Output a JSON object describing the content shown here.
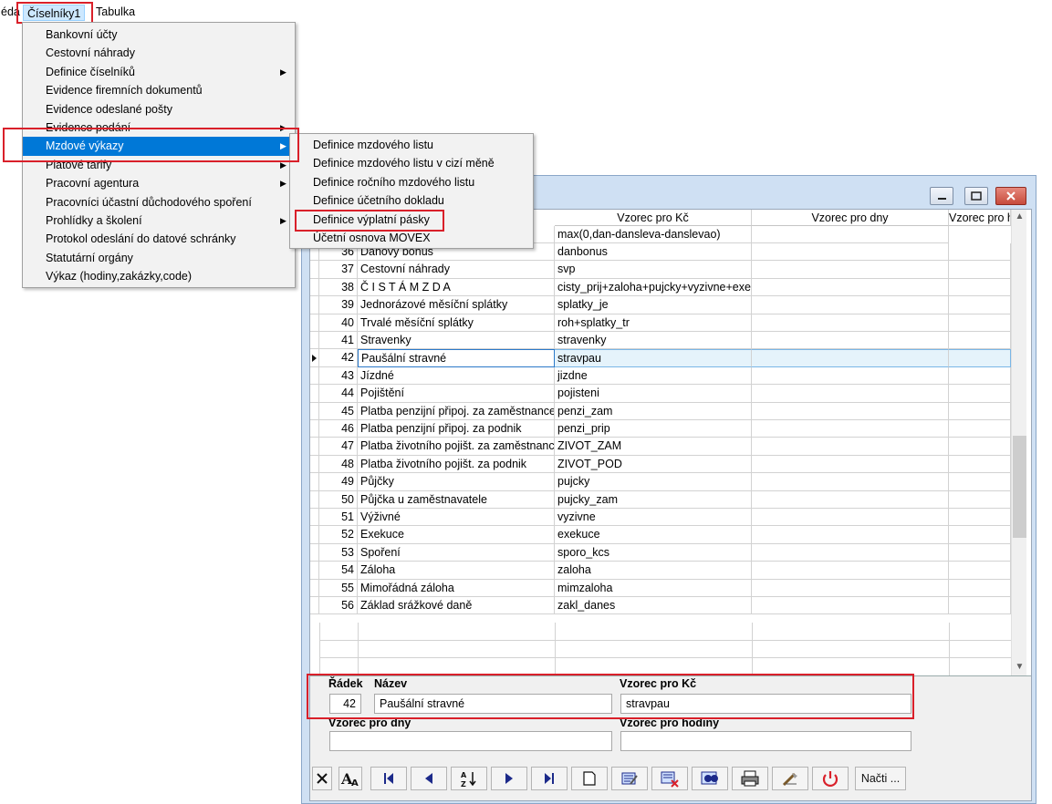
{
  "menubar": {
    "partial_left": "éda",
    "ciselniky": "Číselníky1",
    "tabulka": "Tabulka"
  },
  "menu1": [
    {
      "label": "Bankovní účty",
      "sub": false
    },
    {
      "label": "Cestovní náhrady",
      "sub": false
    },
    {
      "label": "Definice číselníků",
      "sub": true
    },
    {
      "label": "Evidence firemních dokumentů",
      "sub": false
    },
    {
      "label": "Evidence odeslané pošty",
      "sub": false
    },
    {
      "label": "Evidence podání",
      "sub": true
    },
    {
      "label": "Mzdové výkazy",
      "sub": true,
      "selected": true
    },
    {
      "label": "Platové tarify",
      "sub": true
    },
    {
      "label": "Pracovní agentura",
      "sub": true
    },
    {
      "label": "Pracovníci  účastní důchodového spoření",
      "sub": false
    },
    {
      "label": "Prohlídky a školení",
      "sub": true
    },
    {
      "label": "Protokol odeslání do datové schránky",
      "sub": false
    },
    {
      "label": "Statutární orgány",
      "sub": false
    },
    {
      "label": "Výkaz (hodiny,zakázky,code)",
      "sub": false
    }
  ],
  "menu2": [
    {
      "label": "Definice mzdového listu"
    },
    {
      "label": "Definice mzdového listu v cizí měně"
    },
    {
      "label": "Definice ročního mzdového listu"
    },
    {
      "label": "Definice účetního dokladu"
    },
    {
      "label": "Definice výplatní pásky"
    },
    {
      "label": "Účetní osnova MOVEX"
    }
  ],
  "grid": {
    "headers": [
      "Vzorec pro Kč",
      "Vzorec pro dny",
      "Vzorec pro h"
    ],
    "top_partial": {
      "formula": "max(0,dan-dansleva-danslevao)"
    },
    "rows": [
      {
        "num": "36",
        "name": "Daňový bonus",
        "formula": "danbonus"
      },
      {
        "num": "37",
        "name": "Cestovní náhrady",
        "formula": "svp"
      },
      {
        "num": "38",
        "name": "Č I S T Á  M Z D A",
        "formula": "cisty_prij+zaloha+pujcky+vyzivne+exe"
      },
      {
        "num": "39",
        "name": "Jednorázové měsíční splátky",
        "formula": "splatky_je"
      },
      {
        "num": "40",
        "name": "Trvalé měsíční splátky",
        "formula": "roh+splatky_tr"
      },
      {
        "num": "41",
        "name": "Stravenky",
        "formula": "stravenky"
      },
      {
        "num": "42",
        "name": "Paušální stravné",
        "formula": "stravpau",
        "current": true
      },
      {
        "num": "43",
        "name": "Jízdné",
        "formula": "jizdne"
      },
      {
        "num": "44",
        "name": "Pojištění",
        "formula": "pojisteni"
      },
      {
        "num": "45",
        "name": "Platba penzijní připoj. za zaměstnance",
        "formula": "penzi_zam"
      },
      {
        "num": "46",
        "name": "Platba penzijní připoj. za podnik",
        "formula": "penzi_prip"
      },
      {
        "num": "47",
        "name": "Platba životního pojišt. za zaměstnance",
        "formula": "ZIVOT_ZAM"
      },
      {
        "num": "48",
        "name": "Platba životního pojišt. za podnik",
        "formula": "ZIVOT_POD"
      },
      {
        "num": "49",
        "name": "Půjčky",
        "formula": "pujcky"
      },
      {
        "num": "50",
        "name": "Půjčka u zaměstnavatele",
        "formula": "pujcky_zam"
      },
      {
        "num": "51",
        "name": "Výživné",
        "formula": "vyzivne"
      },
      {
        "num": "52",
        "name": "Exekuce",
        "formula": "exekuce"
      },
      {
        "num": "53",
        "name": "Spoření",
        "formula": "sporo_kcs"
      },
      {
        "num": "54",
        "name": "Záloha",
        "formula": "zaloha"
      },
      {
        "num": "55",
        "name": "Mimořádná záloha",
        "formula": "mimzaloha"
      },
      {
        "num": "56",
        "name": "Základ srážkové daně",
        "formula": "zakl_danes"
      }
    ]
  },
  "detail": {
    "radek_label": "Řádek",
    "radek_value": "42",
    "nazev_label": "Název",
    "nazev_value": "Paušální stravné",
    "kc_label": "Vzorec pro Kč",
    "kc_value": "stravpau",
    "dny_label": "Vzorec pro dny",
    "dny_value": "",
    "hodiny_label": "Vzorec pro hodiny",
    "hodiny_value": ""
  },
  "toolbar": {
    "nacti_label": "Načti ..."
  },
  "colors": {
    "accent": "#0078d7",
    "highlight_box": "#d9202a",
    "window_frame": "#cfe0f3"
  }
}
